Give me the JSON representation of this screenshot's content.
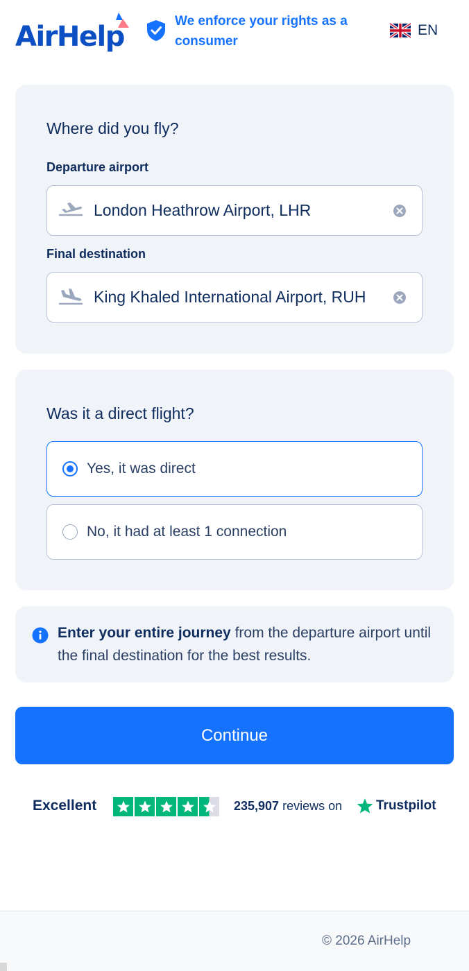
{
  "header": {
    "brand": "AirHelp",
    "tagline": "We enforce your rights as a consumer",
    "language": "EN"
  },
  "flight": {
    "title": "Where did you fly?",
    "departure_label": "Departure airport",
    "departure_value": "London Heathrow Airport, LHR",
    "destination_label": "Final destination",
    "destination_value": "King Khaled International Airport, RUH"
  },
  "direct": {
    "title": "Was it a direct flight?",
    "options": [
      {
        "label": "Yes, it was direct",
        "selected": true
      },
      {
        "label": "No, it had at least 1 connection",
        "selected": false
      }
    ]
  },
  "info": {
    "bold": "Enter your entire journey",
    "text": " from the departure airport until the final destination for the best results."
  },
  "continue_label": "Continue",
  "trustpilot": {
    "rating_label": "Excellent",
    "stars": 4.5,
    "review_count": "235,907",
    "reviews_on": " reviews on",
    "brand": "Trustpilot"
  },
  "footer": {
    "copyright": "© 2026 AirHelp"
  },
  "colors": {
    "primary": "#1472ff",
    "navy": "#0e2c5e",
    "card": "#f0f3f8",
    "trustpilot": "#00b67a"
  }
}
